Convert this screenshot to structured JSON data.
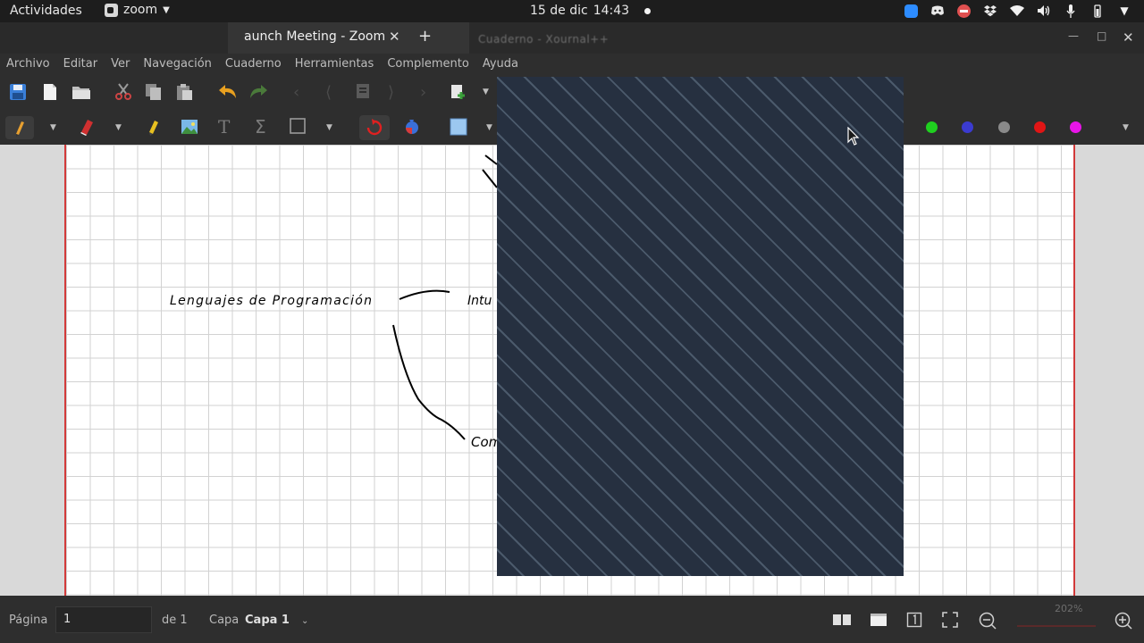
{
  "topbar": {
    "activities": "Actividades",
    "app_name": "zoom",
    "date": "15 de dic",
    "time": "14:43"
  },
  "titlebar": {
    "tab_title": "aunch Meeting - Zoom",
    "new_tab": "+",
    "ghost_title": "Cuaderno - Xournal++"
  },
  "menubar": {
    "items": [
      "Archivo",
      "Editar",
      "Ver",
      "Navegación",
      "Cuaderno",
      "Herramientas",
      "Complemento",
      "Ayuda"
    ]
  },
  "toolbar2": {
    "pen_colors": [
      "#1fd01f",
      "#3b3bd0",
      "#8a8a8a",
      "#e01515",
      "#e815e8"
    ]
  },
  "canvas": {
    "handwriting": [
      "Lenguajes de Programación",
      "Intu",
      "Com"
    ]
  },
  "statusbar": {
    "page_label": "Página",
    "page_value": "1",
    "of_label": "de 1",
    "layer_label": "Capa",
    "layer_value": "Capa 1",
    "zoom_percent": "202%"
  },
  "colors": {
    "page_border": "#d23a3a",
    "overlay": "#263040"
  }
}
